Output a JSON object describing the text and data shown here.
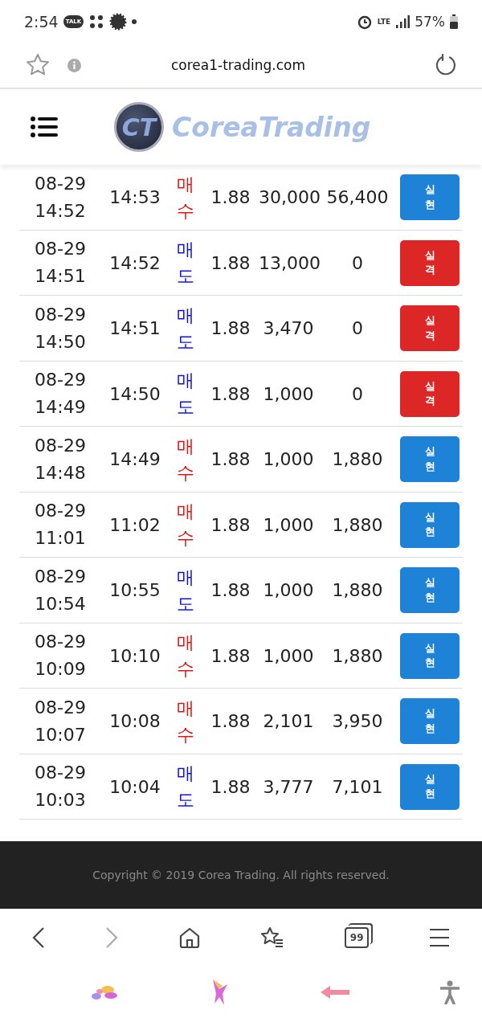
{
  "status_bar": {
    "time": "2:54",
    "talk_badge": "TALK",
    "network": "LTE",
    "battery": "57%"
  },
  "browser_bar": {
    "url": "corea1-trading.com"
  },
  "header": {
    "logo_mark": "CT",
    "logo_text": "CoreaTrading"
  },
  "rows": [
    {
      "column_1": [
        "08-29",
        "14:52"
      ],
      "column_2": "14:53",
      "column_3": {
        "text": "매수",
        "color": "#e31414"
      },
      "column_4": "1.88",
      "column_5": "30,000",
      "column_6": "56,400",
      "column_7": {
        "text": "실현",
        "color": "#1e82d6"
      }
    },
    {
      "column_1": [
        "08-29",
        "14:51"
      ],
      "column_2": "14:52",
      "column_3": {
        "text": "매도",
        "color": "#1212d6"
      },
      "column_4": "1.88",
      "column_5": "13,000",
      "column_6": "0",
      "column_7": {
        "text": "실격",
        "color": "#dd2626"
      }
    },
    {
      "column_1": [
        "08-29",
        "14:50"
      ],
      "column_2": "14:51",
      "column_3": {
        "text": "매도",
        "color": "#1212d6"
      },
      "column_4": "1.88",
      "column_5": "3,470",
      "column_6": "0",
      "column_7": {
        "text": "실격",
        "color": "#dd2626"
      }
    },
    {
      "column_1": [
        "08-29",
        "14:49"
      ],
      "column_2": "14:50",
      "column_3": {
        "text": "매도",
        "color": "#1212d6"
      },
      "column_4": "1.88",
      "column_5": "1,000",
      "column_6": "0",
      "column_7": {
        "text": "실격",
        "color": "#dd2626"
      }
    },
    {
      "column_1": [
        "08-29",
        "14:48"
      ],
      "column_2": "14:49",
      "column_3": {
        "text": "매수",
        "color": "#e31414"
      },
      "column_4": "1.88",
      "column_5": "1,000",
      "column_6": "1,880",
      "column_7": {
        "text": "실현",
        "color": "#1e82d6"
      }
    },
    {
      "column_1": [
        "08-29",
        "11:01"
      ],
      "column_2": "11:02",
      "column_3": {
        "text": "매수",
        "color": "#e31414"
      },
      "column_4": "1.88",
      "column_5": "1,000",
      "column_6": "1,880",
      "column_7": {
        "text": "실현",
        "color": "#1e82d6"
      }
    },
    {
      "column_1": [
        "08-29",
        "10:54"
      ],
      "column_2": "10:55",
      "column_3": {
        "text": "매도",
        "color": "#1212d6"
      },
      "column_4": "1.88",
      "column_5": "1,000",
      "column_6": "1,880",
      "column_7": {
        "text": "실현",
        "color": "#1e82d6"
      }
    },
    {
      "column_1": [
        "08-29",
        "10:09"
      ],
      "column_2": "10:10",
      "column_3": {
        "text": "매수",
        "color": "#e31414"
      },
      "column_4": "1.88",
      "column_5": "1,000",
      "column_6": "1,880",
      "column_7": {
        "text": "실현",
        "color": "#1e82d6"
      }
    },
    {
      "column_1": [
        "08-29",
        "10:07"
      ],
      "column_2": "10:08",
      "column_3": {
        "text": "매수",
        "color": "#e31414"
      },
      "column_4": "1.88",
      "column_5": "2,101",
      "column_6": "3,950",
      "column_7": {
        "text": "실현",
        "color": "#1e82d6"
      }
    },
    {
      "column_1": [
        "08-29",
        "10:03"
      ],
      "column_2": "10:04",
      "column_3": {
        "text": "매도",
        "color": "#1212d6"
      },
      "column_4": "1.88",
      "column_5": "3,777",
      "column_6": "7,101",
      "column_7": {
        "text": "실현",
        "color": "#1e82d6"
      }
    }
  ],
  "footer": {
    "copyright": "Copyright © 2019 Corea Trading. All rights reserved."
  },
  "bottom_toolbar": {
    "tabs_count": "99"
  }
}
